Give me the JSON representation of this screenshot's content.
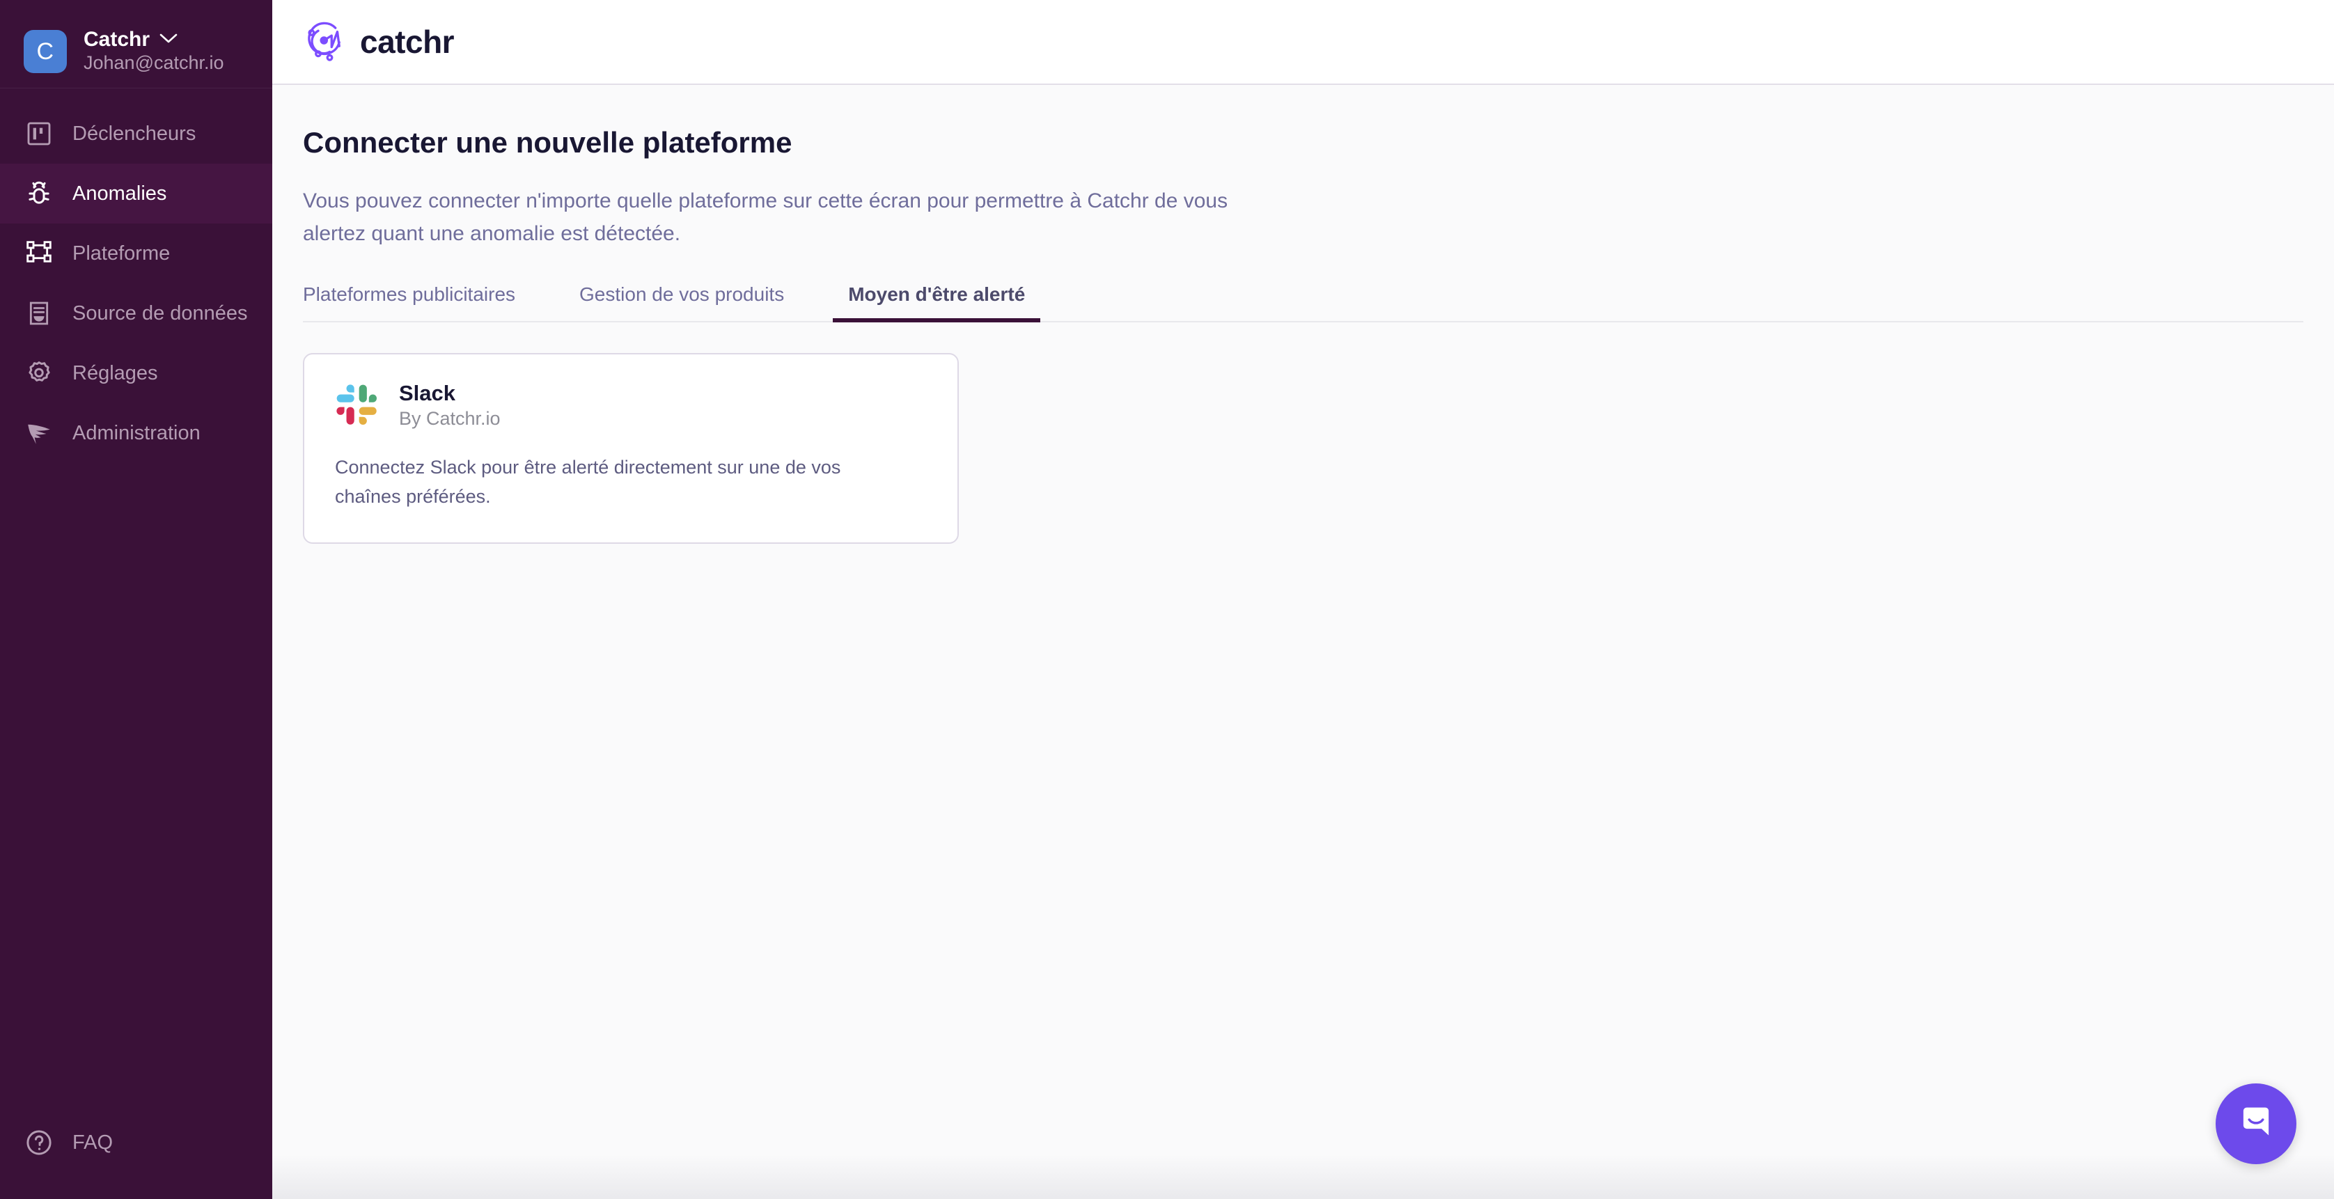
{
  "sidebar": {
    "account": {
      "avatar_initial": "C",
      "name": "Catchr",
      "email": "Johan@catchr.io",
      "chevron_icon": "chevron-down-icon"
    },
    "items": [
      {
        "label": "Déclencheurs",
        "icon": "kanban-board-icon",
        "active": false
      },
      {
        "label": "Anomalies",
        "icon": "bug-icon",
        "active": true
      },
      {
        "label": "Plateforme",
        "icon": "artboard-frame-icon",
        "active": false
      },
      {
        "label": "Source de données",
        "icon": "document-data-icon",
        "active": false
      },
      {
        "label": "Réglages",
        "icon": "gear-icon",
        "active": false
      },
      {
        "label": "Administration",
        "icon": "wing-icon",
        "active": false
      }
    ],
    "faq": {
      "label": "FAQ",
      "icon": "question-circle-icon"
    }
  },
  "header": {
    "logo_icon": "catchr-network-logo-icon",
    "logo_text": "catchr"
  },
  "page": {
    "title": "Connecter une nouvelle plateforme",
    "description": "Vous pouvez connecter n'importe quelle plateforme sur cette écran pour permettre à Catchr de vous alertez quant une anomalie est détectée."
  },
  "tabs": [
    {
      "label": "Plateformes publicitaires",
      "active": false
    },
    {
      "label": "Gestion de vos produits",
      "active": false
    },
    {
      "label": "Moyen d'être alerté",
      "active": true
    }
  ],
  "cards": [
    {
      "logo_icon": "slack-logo-icon",
      "title": "Slack",
      "subtitle": "By Catchr.io",
      "body": "Connectez Slack pour être alerté directement sur une de vos chaînes préférées."
    }
  ],
  "chat": {
    "icon": "chat-bubble-smile-icon"
  },
  "colors": {
    "sidebar_bg": "#3a1138",
    "sidebar_active_bg": "#451542",
    "avatar_bg": "#4a7fd4",
    "accent_underline": "#3a1138",
    "chat_purple": "#6d4aeb",
    "logo_purple": "#7c4dff",
    "title_navy": "#191733",
    "muted_purple": "#6f6d9b",
    "page_bg": "#fafafb"
  }
}
